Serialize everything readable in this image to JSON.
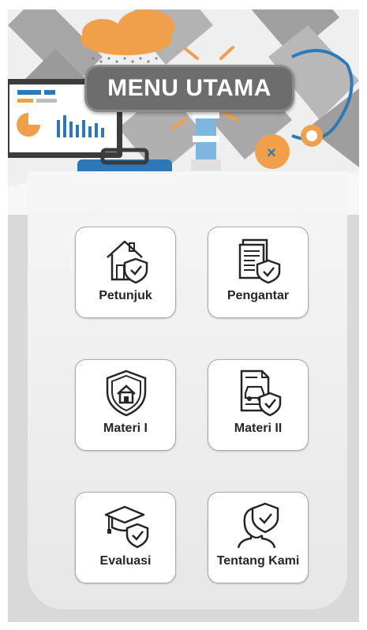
{
  "header": {
    "title": "MENU UTAMA"
  },
  "menu": {
    "items": [
      {
        "label": "Petunjuk",
        "icon": "home-shield-icon"
      },
      {
        "label": "Pengantar",
        "icon": "document-shield-icon"
      },
      {
        "label": "Materi I",
        "icon": "shield-house-icon"
      },
      {
        "label": "Materi II",
        "icon": "car-document-shield-icon"
      },
      {
        "label": "Evaluasi",
        "icon": "graduation-cap-shield-icon"
      },
      {
        "label": "Tentang Kami",
        "icon": "person-shield-icon"
      }
    ]
  },
  "colors": {
    "banner_bg": "#eeeeee",
    "title_pill": "#6d6d6d",
    "accent_orange": "#f0a04b",
    "accent_blue": "#2e78b8",
    "panel": "#f2f2f2"
  }
}
